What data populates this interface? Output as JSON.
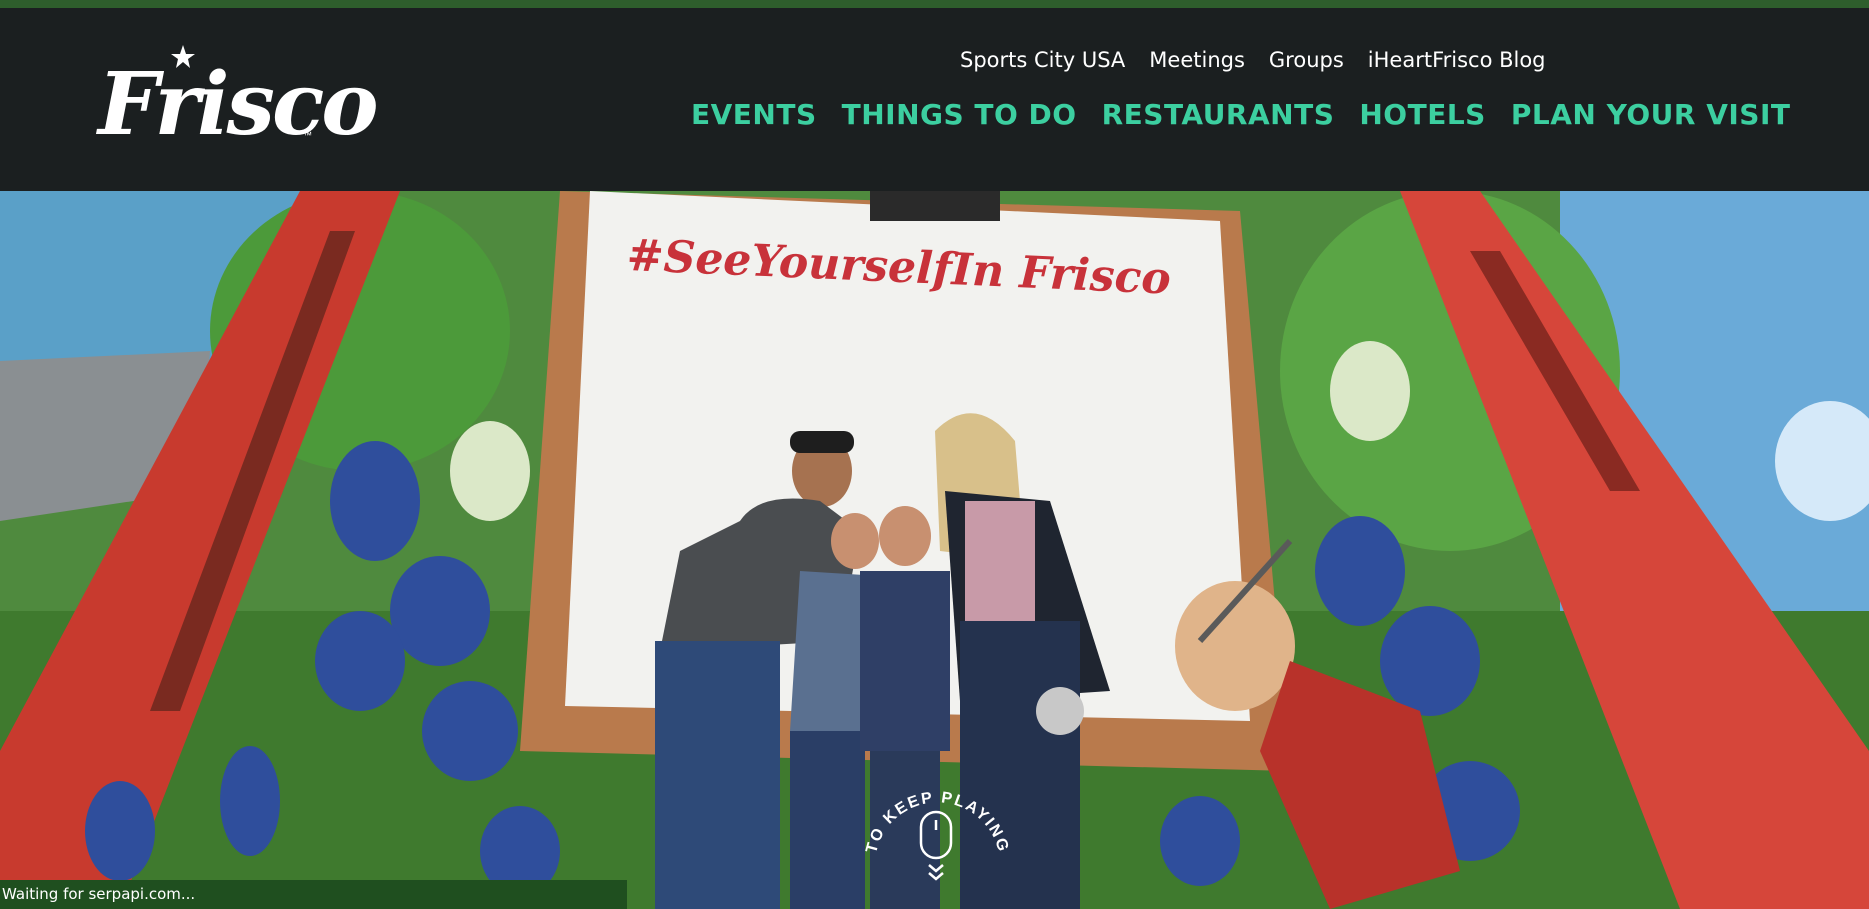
{
  "brand": {
    "name": "Frisco",
    "tm": "™"
  },
  "utility_nav": [
    {
      "label": "Sports City USA"
    },
    {
      "label": "Meetings"
    },
    {
      "label": "Groups"
    },
    {
      "label": "iHeartFrisco Blog"
    }
  ],
  "main_nav": [
    {
      "label": "EVENTS"
    },
    {
      "label": "THINGS TO DO"
    },
    {
      "label": "RESTAURANTS"
    },
    {
      "label": "HOTELS"
    },
    {
      "label": "PLAN YOUR VISIT"
    }
  ],
  "hero": {
    "mural_text": "#SeeYourselfIn Frisco",
    "scroll_cue": "TO KEEP PLAYING"
  },
  "status_bar": {
    "text": "Waiting for serpapi.com..."
  },
  "colors": {
    "nav_accent": "#3ccfa0",
    "header_bg": "#1b1f20",
    "status_bg": "#1f4f1f"
  }
}
